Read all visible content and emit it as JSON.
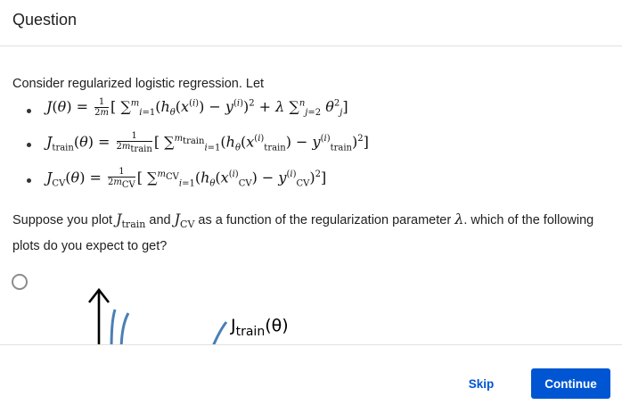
{
  "header": {
    "title": "Question"
  },
  "question": {
    "intro": "Consider regularized logistic regression. Let",
    "definitions": [
      {
        "lhs": "J",
        "arg": "(θ) = ",
        "body": "[Σ(hθ(x(i)) − y(i))² + λ Σ θj²]"
      },
      {
        "lhs": "J",
        "sub": "train",
        "arg": "(θ) = ",
        "body": "[Σ(hθ(x(i)train) − y(i)train)²]"
      },
      {
        "lhs": "J",
        "sub": "CV",
        "arg": "(θ) = ",
        "body": "[Σ(hθ(x(i)CV) − y(i)CV)²]"
      }
    ],
    "prompt_part1": "Suppose you plot ",
    "j_symbol": "J",
    "train_sub": "train",
    "and_text": " and ",
    "cv_sub": "CV",
    "prompt_part2": " as a function of the regularization parameter ",
    "lambda": "λ",
    "prompt_part3": ". which of the following plots do you expect to get?"
  },
  "option_plot": {
    "curve_label_main": "J",
    "curve_label_sub": "train",
    "curve_label_arg": "(θ)"
  },
  "footer": {
    "skip_label": "Skip",
    "continue_label": "Continue"
  },
  "colors": {
    "accent": "#0056d2",
    "curve": "#4a7fb5"
  }
}
